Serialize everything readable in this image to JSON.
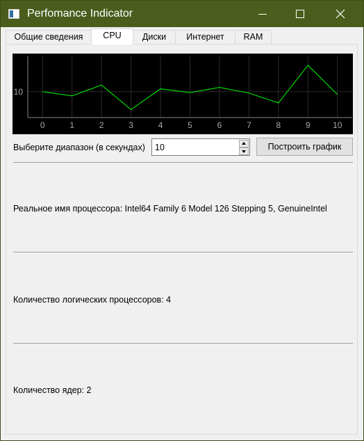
{
  "window": {
    "title": "Perfomance Indicator"
  },
  "tabs": [
    {
      "label": "Общие сведения"
    },
    {
      "label": "CPU"
    },
    {
      "label": "Диски"
    },
    {
      "label": "Интернет"
    },
    {
      "label": "RAM"
    }
  ],
  "active_tab": "CPU",
  "chart_data": {
    "type": "line",
    "x": [
      0,
      1,
      2,
      3,
      4,
      5,
      6,
      7,
      8,
      9,
      10
    ],
    "series": [
      {
        "values": [
          10.0,
          9.1,
          11.4,
          6.2,
          10.6,
          9.8,
          10.9,
          9.7,
          7.6,
          15.6,
          9.4
        ]
      }
    ],
    "x_ticks": [
      "0",
      "1",
      "2",
      "3",
      "4",
      "5",
      "6",
      "7",
      "8",
      "9",
      "10"
    ],
    "y_ticks": [
      "10"
    ],
    "xlim": [
      -0.5,
      10.5
    ],
    "ylim": [
      4.5,
      17.5
    ],
    "grid": true,
    "background": "#000000",
    "line_color": "#00ff00",
    "grid_color": "#2b2b2b",
    "axis_color": "#8a8a8a",
    "tick_label_color": "#a8a8a8"
  },
  "range": {
    "label": "Выберите диапазон (в секундах)",
    "value": "10"
  },
  "build_button": {
    "label": "Построить график"
  },
  "info": {
    "processor_name": "Реальное имя процессора: Intel64 Family 6 Model 126 Stepping 5, GenuineIntel",
    "logical_processors": "Количество логических процессоров: 4",
    "cores": "Количество ядер: 2"
  },
  "colors": {
    "titlebar": "#4a5d1c",
    "panel": "#f0f0f0"
  }
}
